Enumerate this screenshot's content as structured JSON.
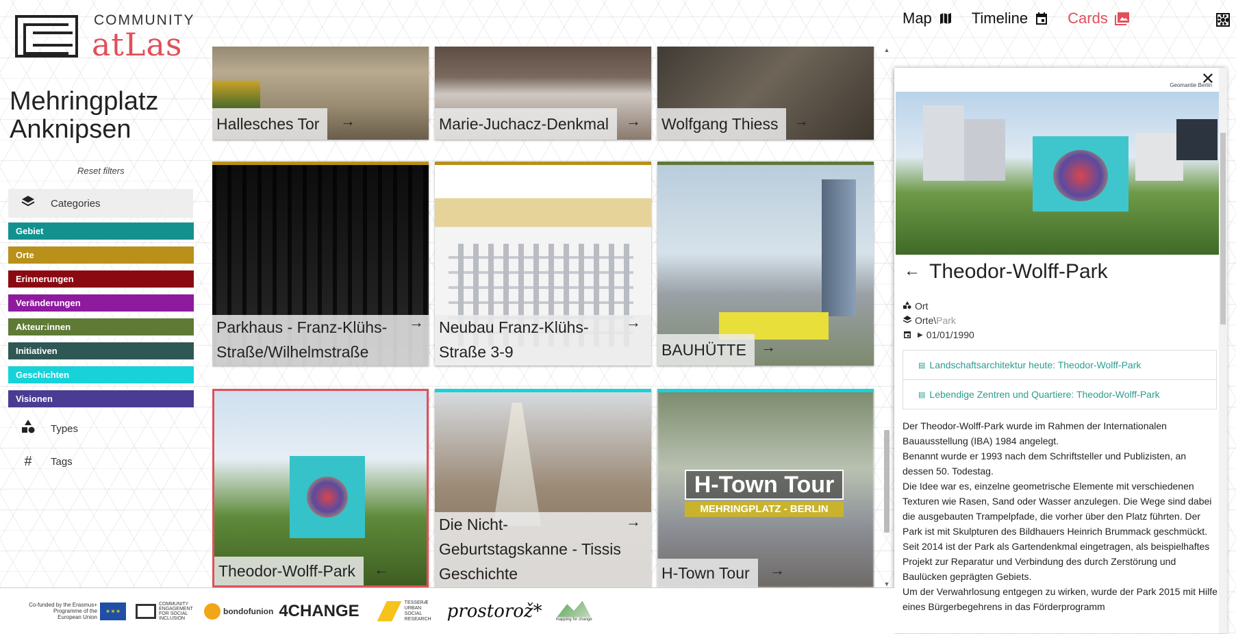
{
  "logo": {
    "community": "COMMUNITY",
    "atlas": "atLas"
  },
  "sidebar": {
    "title_line1": "Mehringplatz",
    "title_line2": "Anknipsen",
    "reset": "Reset filters",
    "categories_label": "Categories",
    "categories": [
      {
        "label": "Gebiet",
        "color": "#13918f"
      },
      {
        "label": "Orte",
        "color": "#b8901a"
      },
      {
        "label": "Erinnerungen",
        "color": "#8b0a12"
      },
      {
        "label": "Veränderungen",
        "color": "#8e1a9e"
      },
      {
        "label": "Akteur:innen",
        "color": "#5e7a35"
      },
      {
        "label": "Initiativen",
        "color": "#2f5754"
      },
      {
        "label": "Geschichten",
        "color": "#17d2d9"
      },
      {
        "label": "Visionen",
        "color": "#4a3b93"
      }
    ],
    "types_label": "Types",
    "tags_label": "Tags"
  },
  "nav": {
    "map": "Map",
    "timeline": "Timeline",
    "cards": "Cards",
    "active_color": "#e0505a"
  },
  "cards": [
    {
      "title": "Hallesches Tor"
    },
    {
      "title": "Marie-Juchacz-Denkmal"
    },
    {
      "title": "Wolfgang Thiess"
    },
    {
      "title_line1": "Parkhaus - Franz-Klühs-",
      "title_line2": "Straße/Wilhelmstraße",
      "bar_color": "#b8901a"
    },
    {
      "title_line1": "Neubau Franz-Klühs-",
      "title_line2": "Straße 3-9",
      "bar_color": "#b8901a"
    },
    {
      "title": "BAUHÜTTE",
      "bar_color": "#5e7a35"
    },
    {
      "title": "Theodor-Wolff-Park",
      "border_color": "#e0505a"
    },
    {
      "title_line1": "Die Nicht-",
      "title_line2": "Geburtstagskanne - Tissis",
      "title_line3": "Geschichte",
      "bar_color": "#17d2d9"
    },
    {
      "title": "H-Town Tour",
      "bar_color": "#17d2d9",
      "banner_line1": "H-Town Tour",
      "banner_line2": "MEHRINGPLATZ - BERLIN"
    }
  ],
  "panel": {
    "credit": "Geomantie Berlin",
    "title": "Theodor-Wolff-Park",
    "type": "Ort",
    "category_parent": "Orte",
    "category_sep": "\\",
    "category_child": "Park",
    "date": "01/01/1990",
    "links": [
      "Landschaftsarchitektur heute: Theodor-Wolff-Park",
      "Lebendige Zentren und Quartiere: Theodor-Wolff-Park"
    ],
    "description": [
      "Der Theodor-Wolff-Park wurde im Rahmen der Internationalen Bauausstellung (IBA) 1984 angelegt.",
      "Benannt wurde er 1993 nach dem Schriftsteller und Publizisten, an dessen 50. Todestag.",
      "Die Idee war es, einzelne geometrische Elemente mit verschiedenen Texturen wie Rasen, Sand oder Wasser anzulegen. Die Wege sind dabei die ausgebauten Trampelpfade, die vorher über den Platz führten. Der Park ist mit Skulpturen des Bildhauers Heinrich Brummack geschmückt.",
      "Seit 2014 ist der Park als Gartendenkmal eingetragen, als beispielhaftes Projekt zur Reparatur und Verbindung des durch Zerstörung und Baulücken geprägten Gebiets.",
      "Um der Verwahrlosung entgegen zu wirken, wurde der Park 2015 mit Hilfe eines Bürgerbegehrens in das Förderprogramm"
    ]
  },
  "footer": {
    "eu": "Co-funded by the Erasmus+ Programme of the European Union",
    "partner2": "COMMUNITY ENGAGEMENT FOR SOCIAL INCLUSION",
    "bondofunion": "bondofunion",
    "change": "4CHANGE",
    "tesserae": "TESSERÆ URBAN SOCIAL RESEARCH",
    "prostoroz": "prostorož*",
    "mapping": "mapping for change"
  }
}
